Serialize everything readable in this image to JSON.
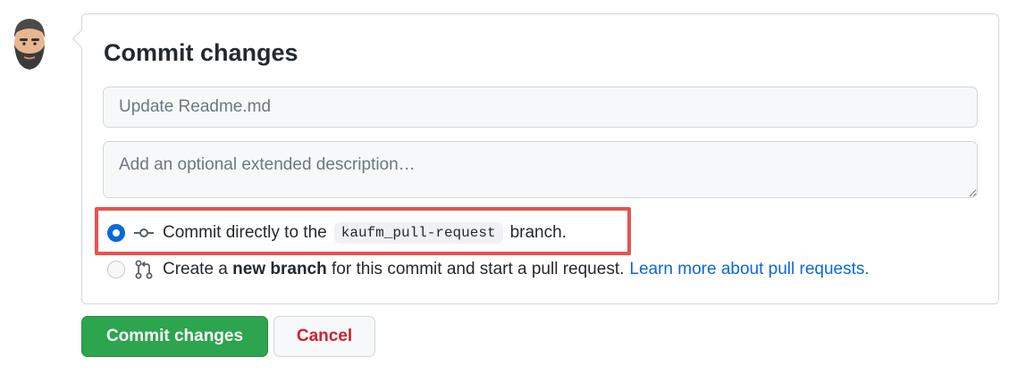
{
  "commit_form": {
    "title": "Commit changes",
    "message_placeholder": "Update Readme.md",
    "description_placeholder": "Add an optional extended description…",
    "option_direct": {
      "text_before": "Commit directly to the",
      "branch": "kaufm_pull-request",
      "text_after": "branch.",
      "selected": true
    },
    "option_new_branch": {
      "text_before": "Create a",
      "bold": "new branch",
      "text_after": "for this commit and start a pull request.",
      "link": "Learn more about pull requests.",
      "selected": false
    }
  },
  "buttons": {
    "commit_label": "Commit changes",
    "cancel_label": "Cancel"
  },
  "icons": {
    "avatar": "bearded-user-avatar",
    "direct": "git-commit-icon",
    "new_branch": "git-pull-request-icon"
  },
  "colors": {
    "accent_blue": "#0969da",
    "commit_green": "#2da44e",
    "cancel_red": "#cf222e",
    "highlight_red": "#e5544f"
  }
}
